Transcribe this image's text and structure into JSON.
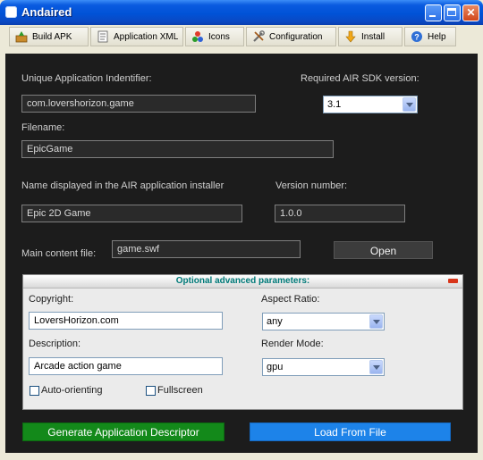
{
  "window": {
    "title": "Andaired"
  },
  "toolbar": {
    "items": [
      {
        "label": "Build APK",
        "icon": "package-icon"
      },
      {
        "label": "Application XML",
        "icon": "document-icon"
      },
      {
        "label": "Icons",
        "icon": "shapes-icon"
      },
      {
        "label": "Configuration",
        "icon": "tools-icon"
      },
      {
        "label": "Install",
        "icon": "download-arrow-icon"
      },
      {
        "label": "Help",
        "icon": "help-icon"
      }
    ]
  },
  "form": {
    "app_id": {
      "label": "Unique Application Indentifier:",
      "value": "com.lovershorizon.game"
    },
    "sdk": {
      "label": "Required AIR SDK version:",
      "value": "3.1"
    },
    "filename": {
      "label": "Filename:",
      "value": "EpicGame"
    },
    "display_name": {
      "label": "Name displayed in the AIR application installer",
      "value": "Epic 2D Game"
    },
    "version": {
      "label": "Version number:",
      "value": "1.0.0"
    },
    "main_content": {
      "label": "Main content file:",
      "value": "game.swf"
    },
    "open_button": "Open"
  },
  "advanced": {
    "title": "Optional advanced parameters:",
    "copyright": {
      "label": "Copyright:",
      "value": "LoversHorizon.com"
    },
    "aspect_ratio": {
      "label": "Aspect Ratio:",
      "value": "any"
    },
    "description": {
      "label": "Description:",
      "value": "Arcade action game"
    },
    "render_mode": {
      "label": "Render Mode:",
      "value": "gpu"
    },
    "auto_orienting": {
      "label": "Auto-orienting",
      "checked": false
    },
    "fullscreen": {
      "label": "Fullscreen",
      "checked": false
    }
  },
  "actions": {
    "generate": "Generate Application Descriptor",
    "load": "Load From File"
  },
  "colors": {
    "titlebar": "#0052d6",
    "panel": "#1c1c1c",
    "advanced_title": "#007a79",
    "generate_button": "#13891a",
    "load_button": "#1d83e9"
  }
}
